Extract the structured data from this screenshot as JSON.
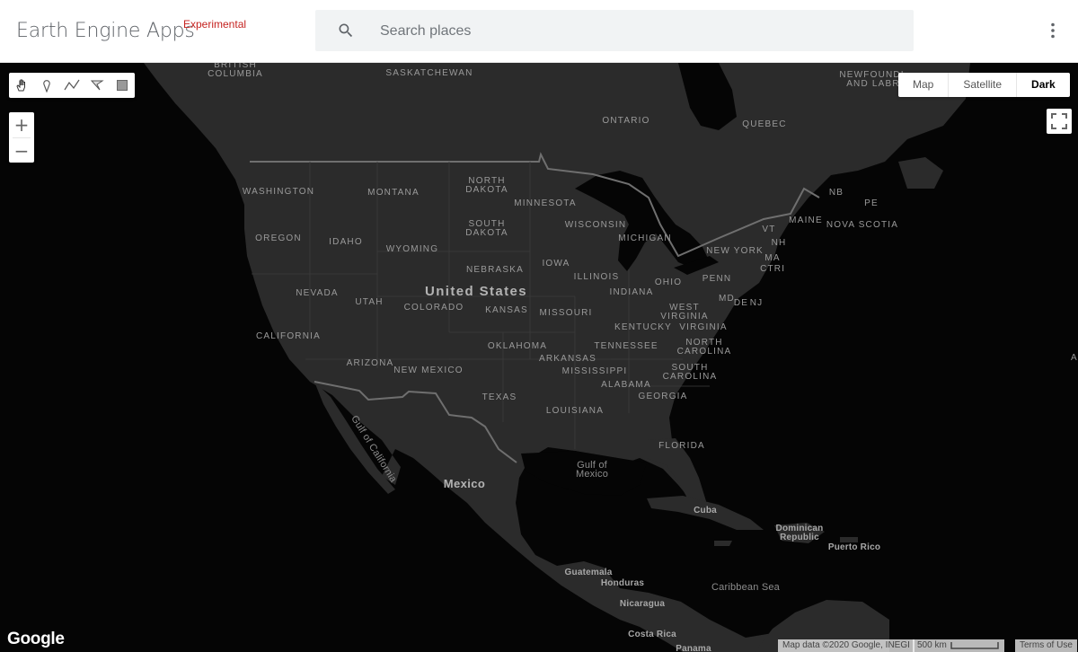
{
  "header": {
    "title": "Earth Engine Apps",
    "badge": "Experimental",
    "search_placeholder": "Search places",
    "search_icon": "search-icon",
    "menu_icon": "more-vert-icon"
  },
  "map": {
    "map_types": [
      "Map",
      "Satellite",
      "Dark"
    ],
    "selected_map_type": "Dark",
    "zoom_in_label": "+",
    "zoom_out_label": "−",
    "drawing_tools": [
      "hand-pan-icon",
      "marker-icon",
      "polyline-icon",
      "polygon-icon",
      "rectangle-icon"
    ],
    "fullscreen_icon": "fullscreen-icon",
    "logo": "Google",
    "attribution": "Map data ©2020 Google, INEGI",
    "scale": "500 km",
    "terms": "Terms of Use",
    "edge_label": "A",
    "labels": {
      "countries": [
        "United States",
        "Mexico"
      ],
      "seas": [
        "Gulf of California",
        "Gulf of\nMexico",
        "Caribbean Sea"
      ],
      "regions": [
        "BRITISH\nCOLUMBIA",
        "SASKATCHEWAN",
        "ONTARIO",
        "QUEBEC",
        "NEWFOUNDL\nAND LABR",
        "WASHINGTON",
        "MONTANA",
        "NORTH\nDAKOTA",
        "MINNESOTA",
        "WISCONSIN",
        "MICHIGAN",
        "OREGON",
        "IDAHO",
        "WYOMING",
        "SOUTH\nDAKOTA",
        "NEBRASKA",
        "IOWA",
        "ILLINOIS",
        "INDIANA",
        "OHIO",
        "PENN",
        "NEW YORK",
        "VT",
        "NH",
        "MAINE",
        "NB",
        "PE",
        "NOVA SCOTIA",
        "MA",
        "CT",
        "RI",
        "MD",
        "DE",
        "NJ",
        "NEVADA",
        "UTAH",
        "COLORADO",
        "KANSAS",
        "MISSOURI",
        "WEST\nVIRGINIA",
        "VIRGINIA",
        "KENTUCKY",
        "CALIFORNIA",
        "ARIZONA",
        "NEW MEXICO",
        "OKLAHOMA",
        "ARKANSAS",
        "TENNESSEE",
        "NORTH\nCAROLINA",
        "SOUTH\nCAROLINA",
        "MISSISSIPPI",
        "ALABAMA",
        "GEORGIA",
        "TEXAS",
        "LOUISIANA",
        "FLORIDA"
      ],
      "places": [
        "Cuba",
        "Dominican\nRepublic",
        "Puerto Rico",
        "Guatemala",
        "Honduras",
        "Nicaragua",
        "Costa Rica",
        "Panama"
      ]
    }
  }
}
